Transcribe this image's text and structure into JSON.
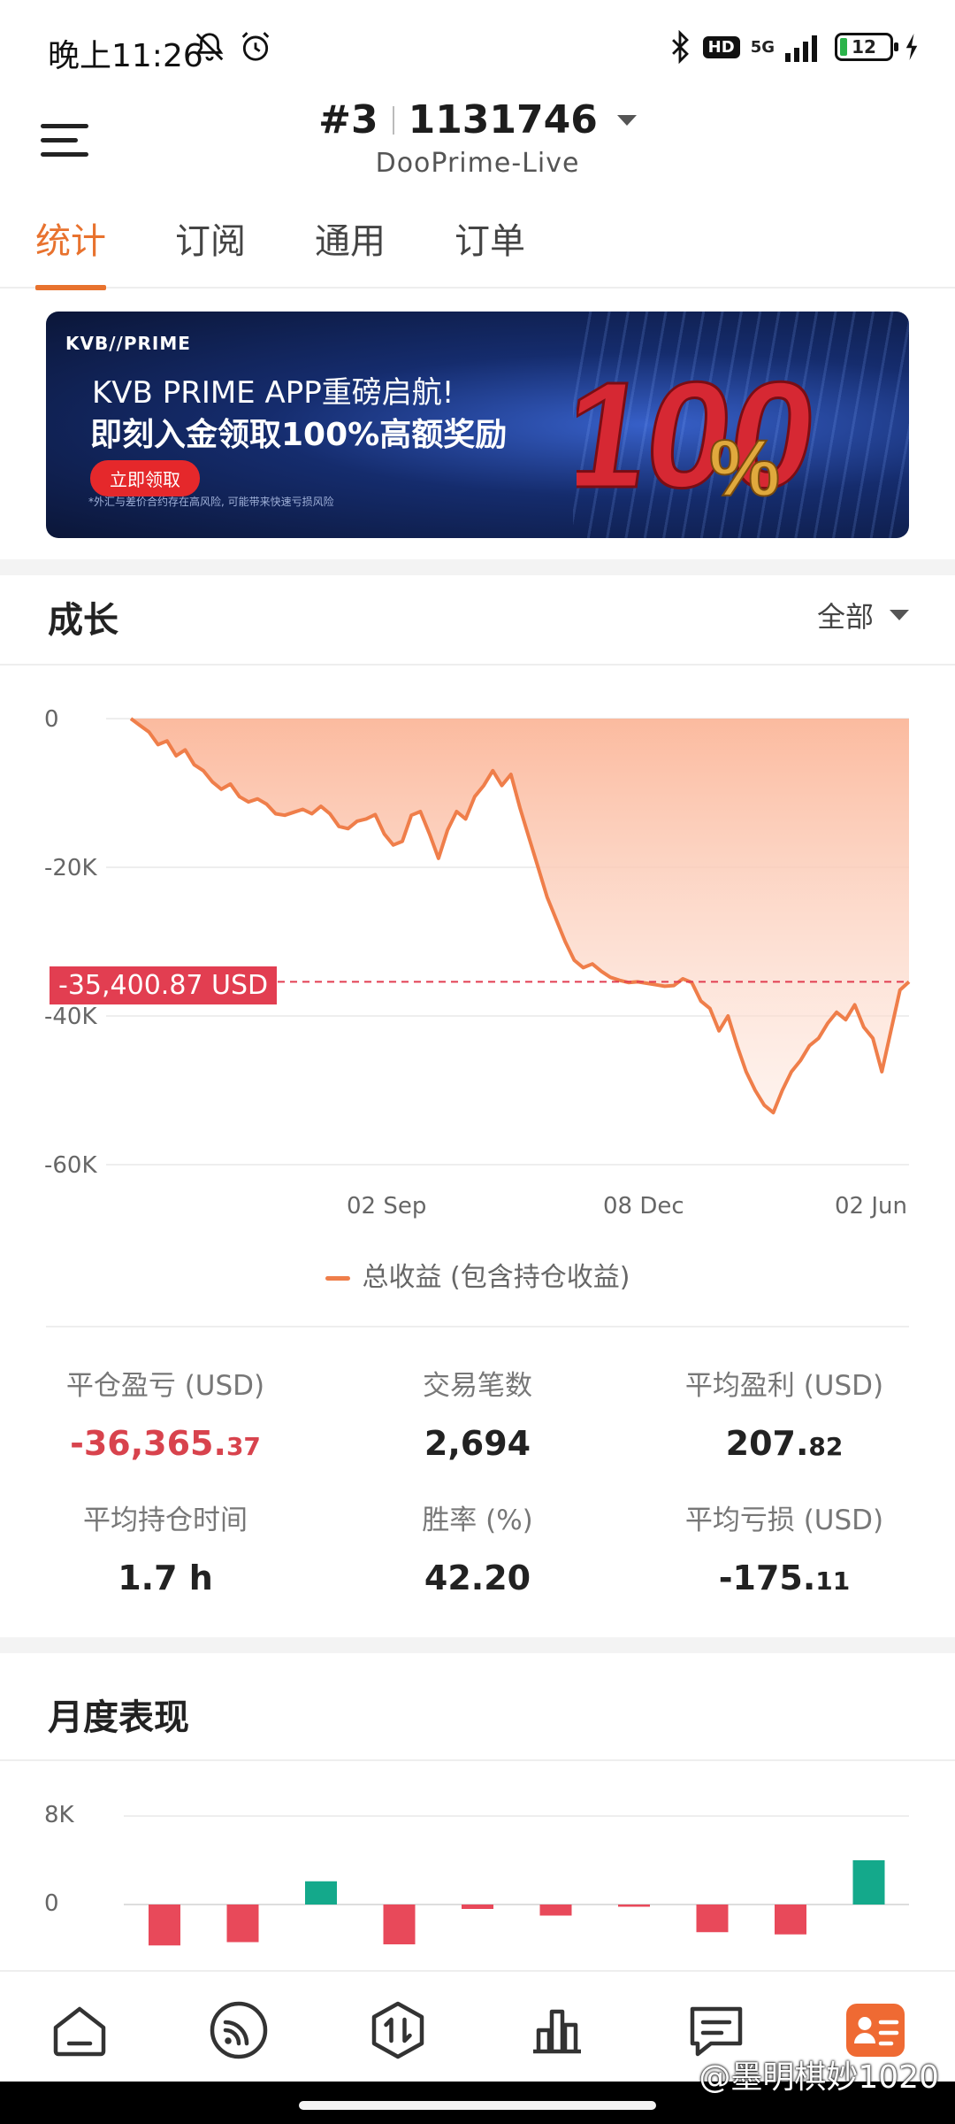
{
  "status_bar": {
    "time": "晚上11:26",
    "network": "5G",
    "battery": "12"
  },
  "header": {
    "account_prefix": "#3",
    "account_number": "1131746",
    "server": "DooPrime-Live"
  },
  "tabs": [
    {
      "label": "统计",
      "active": true
    },
    {
      "label": "订阅",
      "active": false
    },
    {
      "label": "通用",
      "active": false
    },
    {
      "label": "订单",
      "active": false
    }
  ],
  "banner": {
    "logo": "KVB//PRIME",
    "line1": "KVB PRIME APP重磅启航!",
    "line2": "即刻入金领取100%高额奖励",
    "cta": "立即领取",
    "note": "*外汇与差价合约存在高风险, 可能带来快速亏损风险",
    "big_text": "100",
    "big_percent": "%"
  },
  "growth": {
    "title": "成长",
    "range": "全部",
    "legend": "总收益 (包含持仓收益)",
    "current_value": "-35,400.87 USD"
  },
  "chart_data": {
    "type": "area",
    "title": "",
    "xlabel": "",
    "ylabel": "",
    "ylim": [
      -60000,
      0
    ],
    "y_ticks": [
      "0",
      "-20K",
      "-40K",
      "-60K"
    ],
    "x_ticks": [
      "02 Sep",
      "08 Dec",
      "02 Jun"
    ],
    "series": [
      {
        "name": "总收益 (包含持仓收益)",
        "color": "#ef7e4a",
        "values": [
          0,
          -900,
          -1800,
          -3500,
          -3000,
          -5000,
          -4200,
          -6200,
          -7000,
          -8500,
          -9500,
          -8800,
          -10500,
          -11200,
          -10800,
          -11500,
          -12800,
          -13000,
          -12600,
          -12200,
          -12800,
          -11800,
          -12800,
          -14500,
          -14800,
          -13800,
          -13500,
          -12900,
          -15500,
          -17000,
          -16500,
          -13000,
          -12500,
          -15500,
          -18800,
          -15000,
          -12500,
          -13500,
          -10500,
          -9000,
          -7000,
          -9000,
          -7500,
          -12000,
          -16000,
          -20000,
          -24000,
          -27000,
          -30000,
          -32500,
          -33500,
          -33000,
          -34000,
          -34800,
          -35200,
          -35500,
          -35400,
          -35600,
          -35800,
          -36000,
          -35900,
          -35000,
          -35500,
          -38000,
          -39000,
          -42000,
          -40000,
          -44000,
          -47500,
          -50000,
          -52000,
          -53000,
          -50000,
          -47500,
          -46000,
          -44000,
          -43000,
          -41000,
          -39500,
          -40500,
          -38500,
          -41500,
          -43000,
          -47500,
          -42000,
          -36500,
          -35400
        ]
      }
    ],
    "dashed_line_value": -35400.87
  },
  "stats": [
    {
      "label": "平仓盈亏 (USD)",
      "int": "-36,365.",
      "dec": "37",
      "negative": true
    },
    {
      "label": "交易笔数",
      "int": "2,694",
      "dec": "",
      "negative": false
    },
    {
      "label": "平均盈利 (USD)",
      "int": "207.",
      "dec": "82",
      "negative": false
    },
    {
      "label": "平均持仓时间",
      "int": "1.7 h",
      "dec": "",
      "negative": false
    },
    {
      "label": "胜率 (%)",
      "int": "42.20",
      "dec": "",
      "negative": false
    },
    {
      "label": "平均亏损 (USD)",
      "int": "-175.",
      "dec": "11",
      "negative": false
    }
  ],
  "monthly": {
    "title": "月度表现",
    "chart_data": {
      "type": "bar",
      "ylim": [
        -8000,
        8000
      ],
      "y_ticks": [
        "8K",
        "0"
      ],
      "values": [
        -3700,
        -3400,
        2100,
        -3600,
        -400,
        -1000,
        -200,
        -2500,
        -2700,
        4000
      ],
      "positive_color": "#14a98b",
      "negative_color": "#e8495a"
    }
  },
  "bottom_nav": [
    {
      "name": "home-icon"
    },
    {
      "name": "signal-icon"
    },
    {
      "name": "trade-icon"
    },
    {
      "name": "chart-icon"
    },
    {
      "name": "message-icon"
    },
    {
      "name": "profile-icon",
      "active": true
    }
  ],
  "watermark": "@墨明棋妙1020",
  "colors": {
    "accent": "#e8722e",
    "loss": "#d8434d",
    "area_top": "#fcc3a8",
    "line": "#ef7e4a"
  }
}
